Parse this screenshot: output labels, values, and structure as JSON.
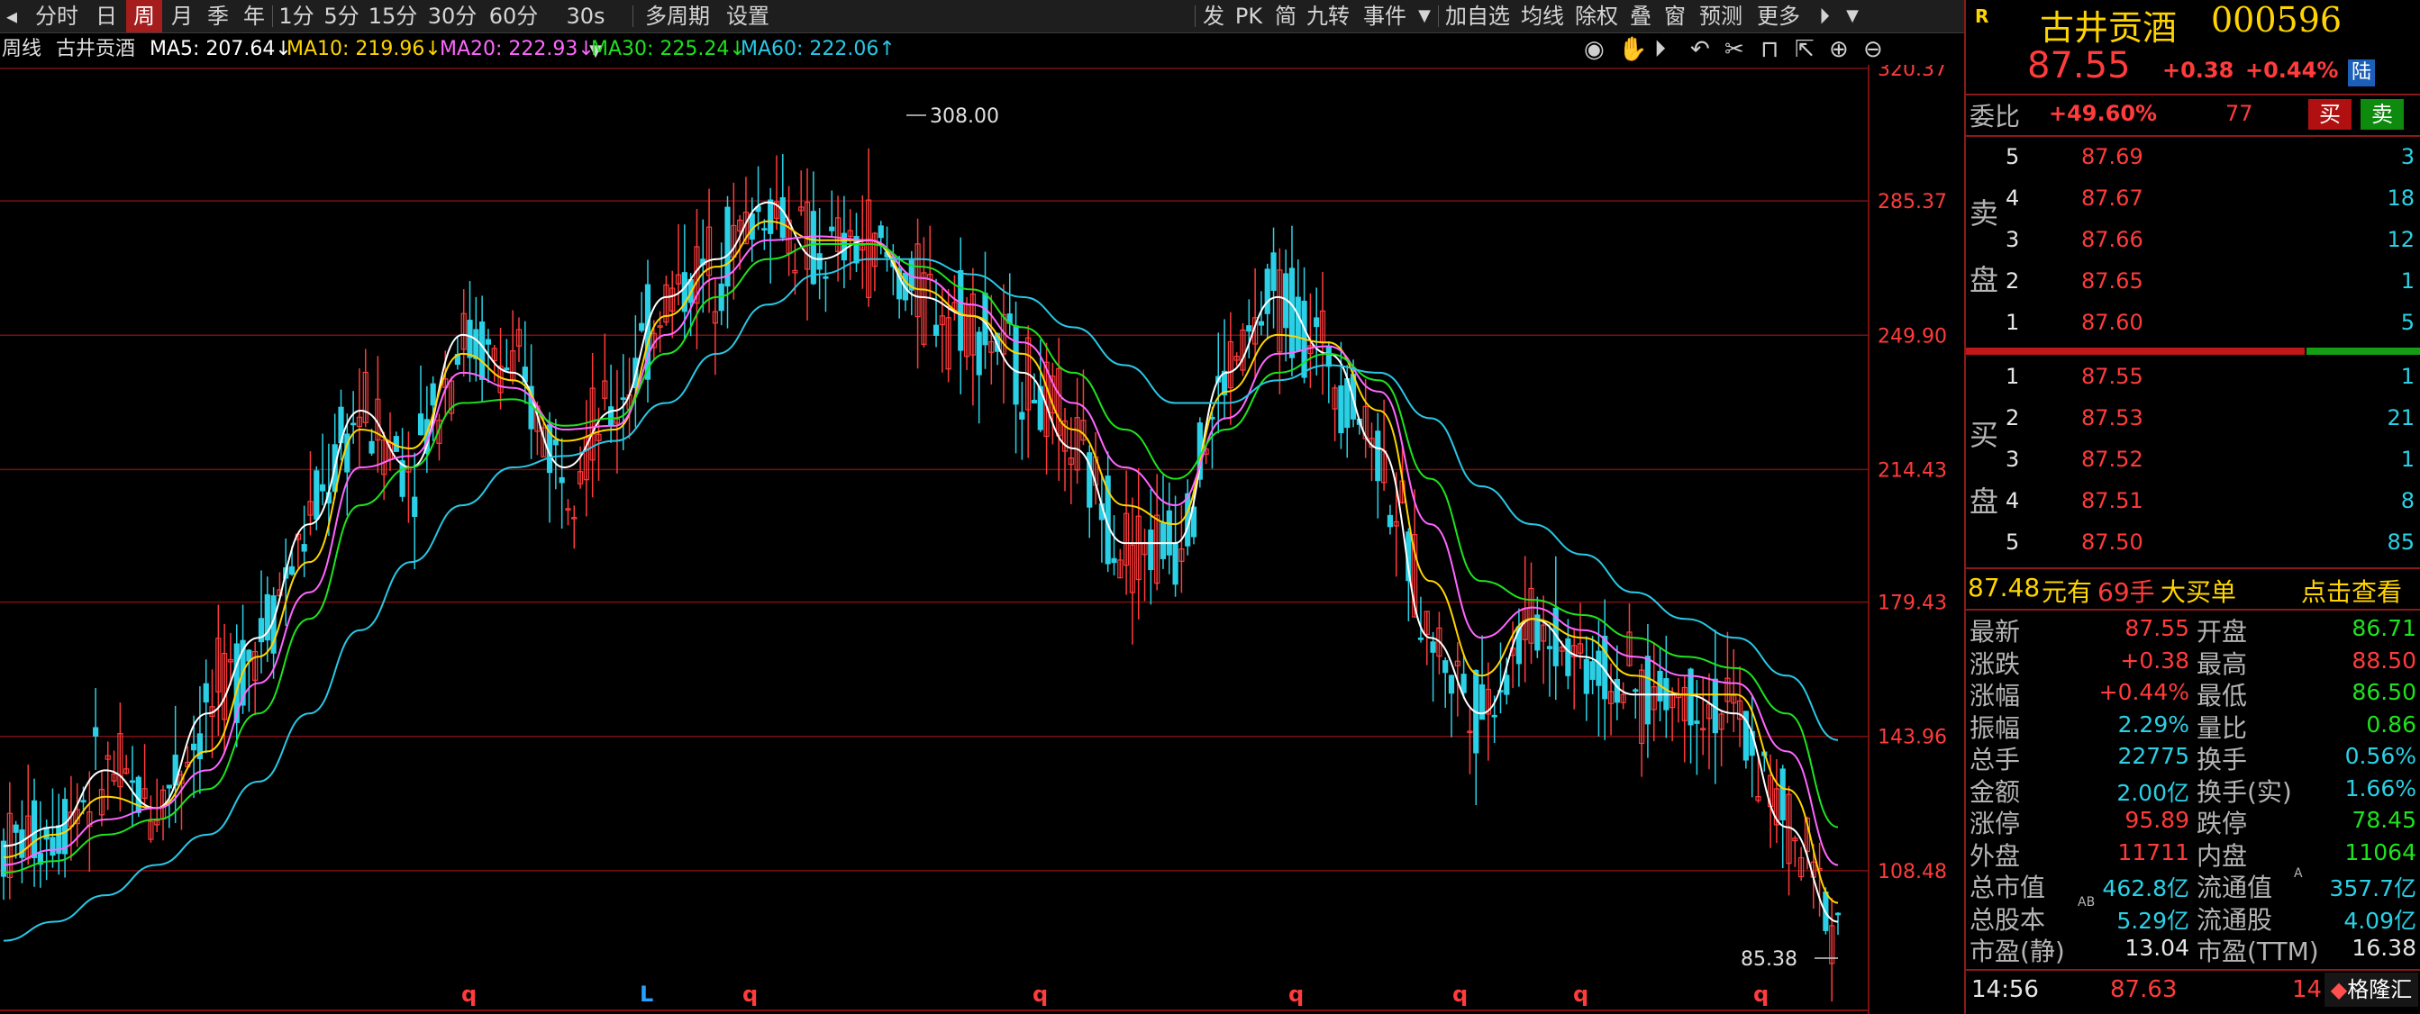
{
  "toolbar": {
    "left_items": [
      "分时",
      "日",
      "周",
      "月",
      "季",
      "年",
      "1分",
      "5分",
      "15分",
      "30分",
      "60分",
      "30s",
      "多周期",
      "设置"
    ],
    "active_item": "周",
    "right_items": [
      "发",
      "PK",
      "简",
      "九转",
      "事件",
      "加自选",
      "均线",
      "除权",
      "叠",
      "窗",
      "预测",
      "更多"
    ]
  },
  "info": {
    "period_label": "周线",
    "stock_name": "古井贡酒",
    "ma5": "MA5: 207.64↓",
    "ma10": "MA10: 219.96↓",
    "ma20": "MA20: 222.93↓",
    "ma30": "MA30: 225.24↓",
    "ma60": "MA60: 222.06↑"
  },
  "colors": {
    "up": "#ff3b3b",
    "down": "#2ad1e6",
    "ma5": "#ffffff",
    "ma10": "#ffd400",
    "ma20": "#ff66ff",
    "ma30": "#1ee31e",
    "ma60": "#28c8e6",
    "grid": "#7a1010"
  },
  "chart_data": {
    "type": "candlestick",
    "title": "古井贡酒 周线",
    "ylim": [
      85.38,
      320.37
    ],
    "y_ticks": [
      "320.37",
      "285.37",
      "249.90",
      "214.43",
      "179.43",
      "143.96",
      "108.48"
    ],
    "annotations": {
      "high_label": "308.00",
      "low_label": "85.38"
    },
    "markers": [
      "q",
      "L",
      "q",
      "q",
      "q",
      "q",
      "q",
      "q"
    ],
    "series": [
      {
        "name": "MA5",
        "values": [
          115,
          120,
          135,
          125,
          150,
          170,
          200,
          230,
          215,
          250,
          240,
          215,
          230,
          260,
          270,
          285,
          270,
          275,
          260,
          255,
          240,
          220,
          195,
          195,
          240,
          260,
          245,
          220,
          170,
          150,
          175,
          165,
          155,
          155,
          150,
          120,
          95
        ]
      },
      {
        "name": "MA10",
        "values": [
          112,
          118,
          128,
          125,
          140,
          165,
          190,
          225,
          220,
          245,
          238,
          222,
          225,
          255,
          268,
          280,
          275,
          275,
          262,
          255,
          245,
          225,
          205,
          200,
          235,
          250,
          248,
          230,
          185,
          160,
          175,
          170,
          160,
          155,
          155,
          130,
          100
        ]
      },
      {
        "name": "MA20",
        "values": [
          110,
          114,
          122,
          125,
          135,
          158,
          182,
          215,
          218,
          240,
          236,
          225,
          226,
          250,
          265,
          275,
          276,
          275,
          265,
          258,
          248,
          232,
          215,
          205,
          228,
          245,
          247,
          235,
          200,
          170,
          178,
          172,
          165,
          160,
          158,
          140,
          110
        ]
      },
      {
        "name": "MA30",
        "values": [
          108,
          111,
          118,
          122,
          130,
          150,
          175,
          205,
          215,
          232,
          233,
          226,
          228,
          245,
          260,
          270,
          274,
          274,
          268,
          262,
          252,
          240,
          225,
          212,
          225,
          240,
          245,
          238,
          212,
          185,
          180,
          176,
          170,
          165,
          162,
          150,
          120
        ]
      },
      {
        "name": "MA60",
        "values": [
          90,
          95,
          102,
          110,
          118,
          132,
          150,
          172,
          190,
          205,
          215,
          218,
          222,
          232,
          245,
          258,
          266,
          270,
          270,
          266,
          260,
          252,
          242,
          232,
          232,
          238,
          242,
          240,
          228,
          210,
          200,
          192,
          182,
          175,
          170,
          160,
          143
        ]
      }
    ]
  },
  "quote": {
    "market_flag": "R",
    "name": "古井贡酒",
    "code": "000596",
    "price": "87.55",
    "change": "+0.38",
    "change_pct": "+0.44%",
    "badge": "陆",
    "weibi_label": "委比",
    "weibi_value": "+49.60%",
    "weicha_value": "77",
    "buy_button": "买",
    "sell_button": "卖",
    "sell_side_label": [
      "卖",
      "盘"
    ],
    "buy_side_label": [
      "买",
      "盘"
    ],
    "asks": [
      {
        "level": "5",
        "price": "87.69",
        "vol": "3"
      },
      {
        "level": "4",
        "price": "87.67",
        "vol": "18"
      },
      {
        "level": "3",
        "price": "87.66",
        "vol": "12"
      },
      {
        "level": "2",
        "price": "87.65",
        "vol": "1"
      },
      {
        "level": "1",
        "price": "87.60",
        "vol": "5"
      }
    ],
    "bids": [
      {
        "level": "1",
        "price": "87.55",
        "vol": "1"
      },
      {
        "level": "2",
        "price": "87.53",
        "vol": "21"
      },
      {
        "level": "3",
        "price": "87.52",
        "vol": "1"
      },
      {
        "level": "4",
        "price": "87.51",
        "vol": "8"
      },
      {
        "level": "5",
        "price": "87.50",
        "vol": "85"
      }
    ],
    "big_order": {
      "price": "87.48",
      "unit": "元有",
      "hands": "69手",
      "label": "大买单",
      "link": "点击查看"
    },
    "stats_left": [
      {
        "label": "最新",
        "value": "87.55",
        "color": "red"
      },
      {
        "label": "涨跌",
        "value": "+0.38",
        "color": "red"
      },
      {
        "label": "涨幅",
        "value": "+0.44%",
        "color": "red"
      },
      {
        "label": "振幅",
        "value": "2.29%",
        "color": "cyan"
      },
      {
        "label": "总手",
        "value": "22775",
        "color": "cyan"
      },
      {
        "label": "金额",
        "value": "2.00亿",
        "color": "cyan"
      },
      {
        "label": "涨停",
        "value": "95.89",
        "color": "red"
      },
      {
        "label": "外盘",
        "value": "11711",
        "color": "red"
      },
      {
        "label": "总市值",
        "value": "462.8亿",
        "color": "cyan"
      },
      {
        "label": "总股本",
        "value": "5.29亿",
        "color": "cyan"
      },
      {
        "label": "市盈(静)",
        "value": "13.04",
        "color": "white"
      }
    ],
    "stats_right": [
      {
        "label": "开盘",
        "value": "86.71",
        "color": "green"
      },
      {
        "label": "最高",
        "value": "88.50",
        "color": "red"
      },
      {
        "label": "最低",
        "value": "86.50",
        "color": "green"
      },
      {
        "label": "量比",
        "value": "0.86",
        "color": "green"
      },
      {
        "label": "换手",
        "value": "0.56%",
        "color": "cyan"
      },
      {
        "label": "换手(实)",
        "value": "1.66%",
        "color": "cyan"
      },
      {
        "label": "跌停",
        "value": "78.45",
        "color": "green"
      },
      {
        "label": "内盘",
        "value": "11064",
        "color": "green"
      },
      {
        "label": "流通值",
        "value": "357.7亿",
        "color": "cyan"
      },
      {
        "label": "流通股",
        "value": "4.09亿",
        "color": "cyan"
      },
      {
        "label": "市盈(TTM)",
        "value": "16.38",
        "color": "white"
      }
    ],
    "sup_ab": "AB",
    "sup_a": "A",
    "sup_a2": "(A)",
    "tick": {
      "time": "14:56",
      "price": "87.63",
      "vol": "14"
    },
    "logo": "格隆汇"
  }
}
